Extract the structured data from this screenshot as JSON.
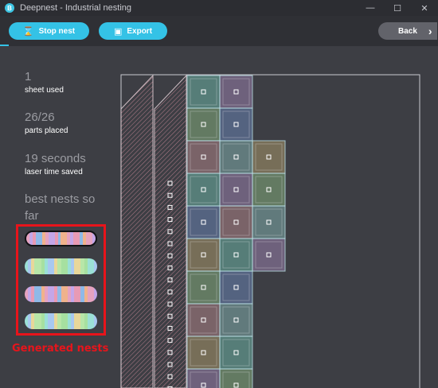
{
  "window": {
    "title": "Deepnest - Industrial nesting",
    "controls": [
      "minimize-icon",
      "maximize-icon",
      "close-icon"
    ]
  },
  "toolbar": {
    "stop_label": "Stop nest",
    "export_label": "Export",
    "back_label": "Back",
    "accent": "#34c2e6"
  },
  "stats": {
    "sheets": {
      "value": "1",
      "label": "sheet used"
    },
    "parts": {
      "value": "26/26",
      "label": "parts placed"
    },
    "time": {
      "value": "19 seconds",
      "label": "laser time saved"
    }
  },
  "best_nests": {
    "title": "best nests so far",
    "count": 4,
    "selected_index": 0
  },
  "annotation": {
    "caption": "Generated nests",
    "color": "#e8141b"
  }
}
